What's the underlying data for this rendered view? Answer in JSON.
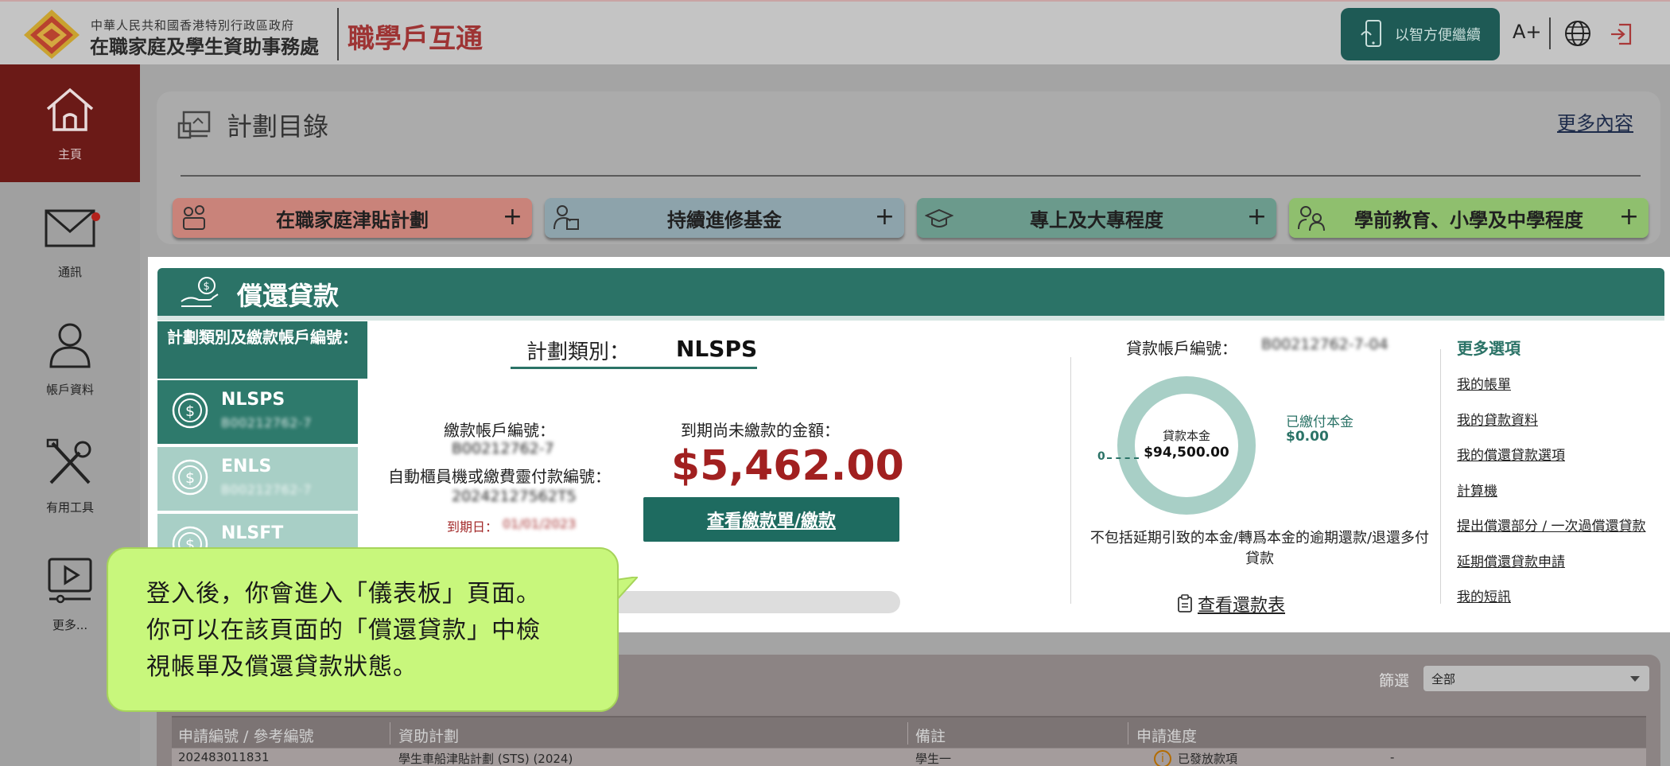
{
  "header": {
    "dept_line1": "中華人民共和國香港特別行政區政府",
    "dept_line2": "在職家庭及學生資助事務處",
    "brand": "職學戶互通",
    "smart_login_label": "以智方便繼續",
    "font_size_label": "A+",
    "globe_icon": "globe-icon",
    "logout_icon": "logout-icon"
  },
  "sidebar": {
    "items": [
      {
        "label": "主頁",
        "icon": "home-icon",
        "active": true
      },
      {
        "label": "通訊",
        "icon": "mail-icon",
        "has_notification": true
      },
      {
        "label": "帳戶資料",
        "icon": "user-icon"
      },
      {
        "label": "有用工具",
        "icon": "tools-icon"
      },
      {
        "label": "更多...",
        "icon": "video-icon"
      }
    ]
  },
  "plan_panel": {
    "title": "計劃目錄",
    "more_link": "更多內容",
    "categories": [
      {
        "label": "在職家庭津貼計劃",
        "color": "#c9837a"
      },
      {
        "label": "持續進修基金",
        "color": "#8da3ab"
      },
      {
        "label": "專上及大專程度",
        "color": "#6b9a8c"
      },
      {
        "label": "學前教育、小學及中學程度",
        "color": "#8fbf6e"
      }
    ],
    "plus": "+"
  },
  "repay": {
    "title": "償還貸款",
    "accounts_header": "計劃類別及繳款帳戶編號：",
    "accounts": [
      {
        "name": "NLSPS",
        "number": "B00212762-7",
        "selected": true
      },
      {
        "name": "ENLS",
        "number": "B00212762-7",
        "selected": false
      },
      {
        "name": "NLSFT",
        "number": "",
        "selected": false
      }
    ],
    "plan_type_label": "計劃類別：",
    "plan_type_value": "NLSPS",
    "payment_account_label": "繳款帳戶編號：",
    "payment_account_value": "B00212762-7",
    "atm_label": "自動櫃員機或繳費靈付款編號：",
    "atm_value": "20242127562T5",
    "due_date_label": "到期日：",
    "due_date_value": "01/01/2023",
    "outstanding_label": "到期尚未繳款的金額：",
    "outstanding_amount": "$5,462.00",
    "view_bill_button": "查看繳款單/繳款",
    "loan_account_label": "貸款帳戶編號：",
    "loan_account_value": "B00212762-7-04",
    "donut": {
      "center_label": "貸款本金",
      "center_value": "$94,500.00",
      "zero_label": "0",
      "paid_label": "已繳付本金",
      "paid_value": "$0.00",
      "paid_fraction": 0,
      "color": "#a8cfc6"
    },
    "note": "不包括延期引致的本金/轉爲本金的逾期還款/退還多付貸款",
    "schedule_link": "查看還款表",
    "more_options_title": "更多選項",
    "more_options": [
      "我的帳單",
      "我的貸款資料",
      "我的償還貸款選項",
      "計算機",
      "提出償還部分 / 一次過償還貸款",
      "延期償還貸款申請",
      "我的短訊"
    ]
  },
  "applications": {
    "filter_label": "篩選",
    "filter_value": "全部",
    "columns": [
      "申請編號 / 參考編號",
      "資助計劃",
      "備註",
      "申請進度"
    ],
    "rows": [
      {
        "ref": "202483011831",
        "scheme": "學生車船津貼計劃 (STS) (2024)",
        "remark": "學生一",
        "status": "已發放款項",
        "extra": "-"
      }
    ]
  },
  "callout": {
    "lines": [
      "登入後，你會進入「儀表板」頁面。",
      "你可以在該頁面的「償還貸款」中檢",
      "視帳單及償還貸款狀態。"
    ]
  }
}
